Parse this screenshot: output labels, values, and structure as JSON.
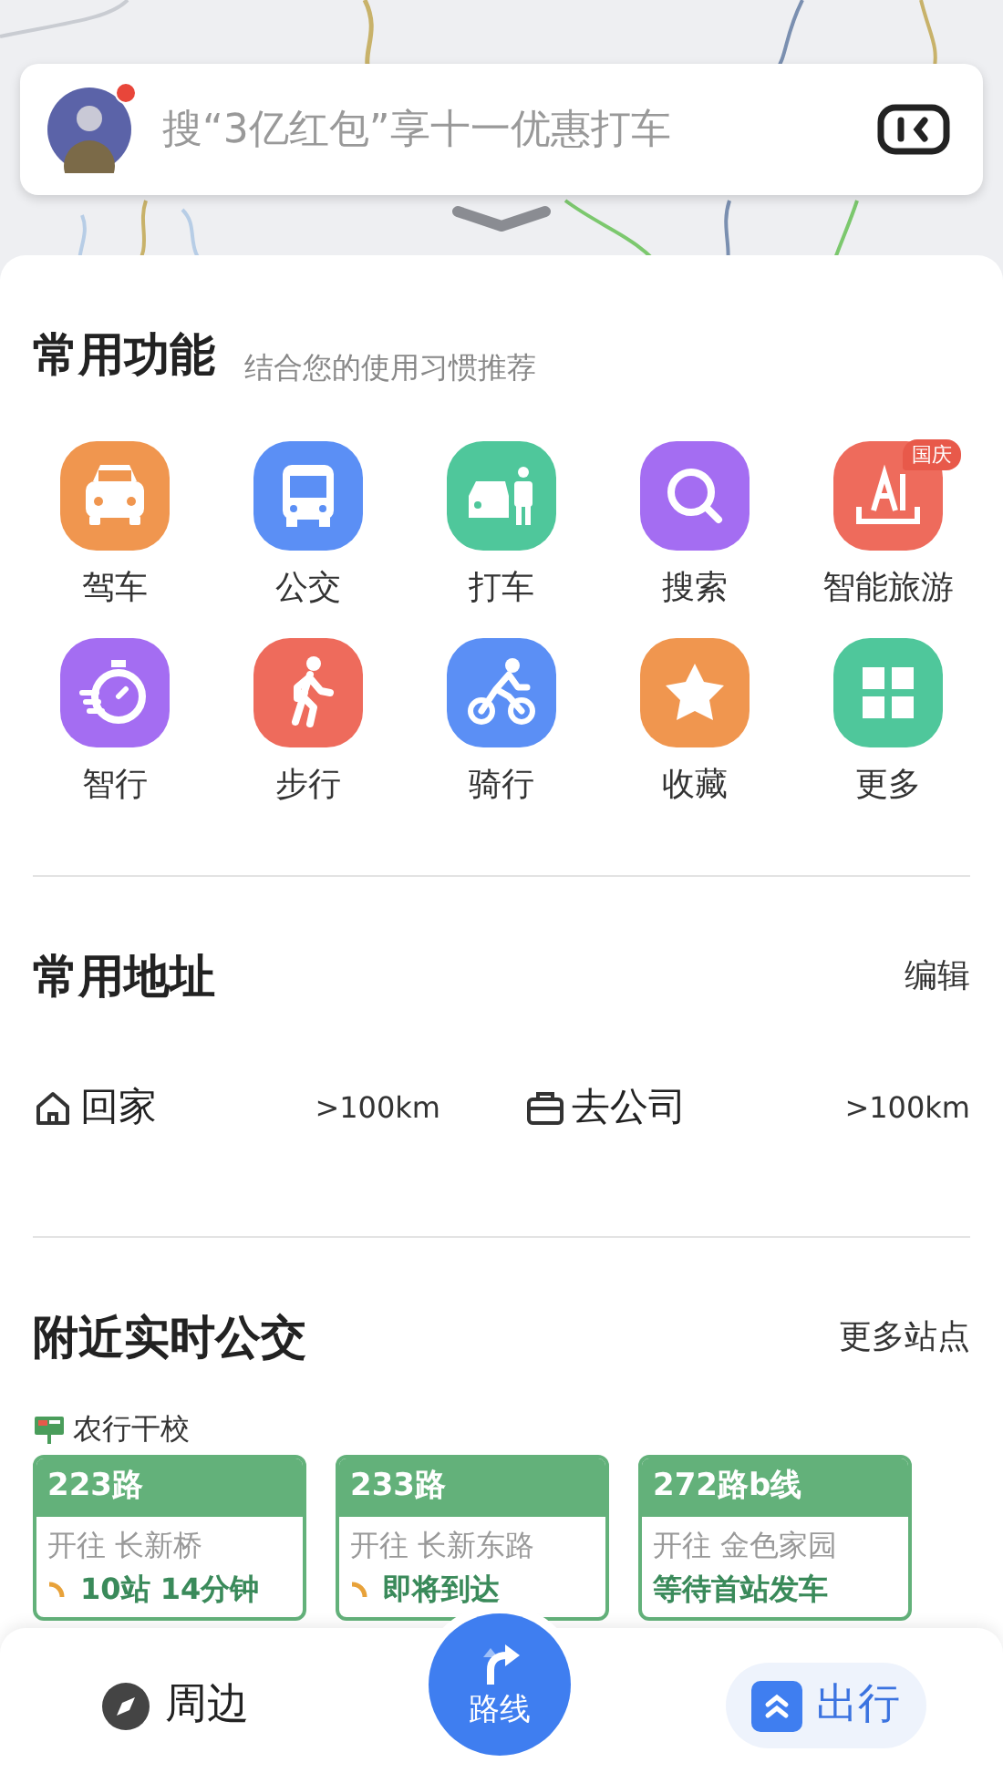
{
  "search": {
    "placeholder": "搜“3亿红包”享十一优惠打车",
    "avatar_notification": true
  },
  "features": {
    "title": "常用功能",
    "subtitle": "结合您的使用习惯推荐",
    "items": [
      {
        "label": "驾车",
        "kind": "car",
        "color": "#f0964f"
      },
      {
        "label": "公交",
        "kind": "bus",
        "color": "#5b8ff5"
      },
      {
        "label": "打车",
        "kind": "taxi",
        "color": "#4fc79b"
      },
      {
        "label": "搜索",
        "kind": "search",
        "color": "#a46df2"
      },
      {
        "label": "智能旅游",
        "kind": "travel",
        "color": "#ee6b5c",
        "badge": "国庆"
      },
      {
        "label": "智行",
        "kind": "timer",
        "color": "#a46df2"
      },
      {
        "label": "步行",
        "kind": "walk",
        "color": "#ee6b5c"
      },
      {
        "label": "骑行",
        "kind": "bike",
        "color": "#5b8ff5"
      },
      {
        "label": "收藏",
        "kind": "star",
        "color": "#f0964f"
      },
      {
        "label": "更多",
        "kind": "grid",
        "color": "#4fc79b"
      }
    ]
  },
  "addresses": {
    "title": "常用地址",
    "action": "编辑",
    "items": [
      {
        "kind": "home",
        "label": "回家",
        "distance": ">100km"
      },
      {
        "kind": "work",
        "label": "去公司",
        "distance": ">100km"
      }
    ]
  },
  "bus": {
    "title": "附近实时公交",
    "action": "更多站点",
    "station": "农行干校",
    "routes": [
      {
        "route": "223路",
        "direction": "开往 长新桥",
        "status": "10站 14分钟",
        "realtime": true
      },
      {
        "route": "233路",
        "direction": "开往 长新东路",
        "status": "即将到达",
        "realtime": true
      },
      {
        "route": "272路b线",
        "direction": "开往 金色家园",
        "status": "等待首站发车",
        "realtime": false
      }
    ]
  },
  "nav": [
    {
      "kind": "tab",
      "label": "周边",
      "selected": false
    },
    {
      "kind": "center",
      "label": "路线",
      "selected": false
    },
    {
      "kind": "tab",
      "label": "出行",
      "selected": true
    }
  ]
}
